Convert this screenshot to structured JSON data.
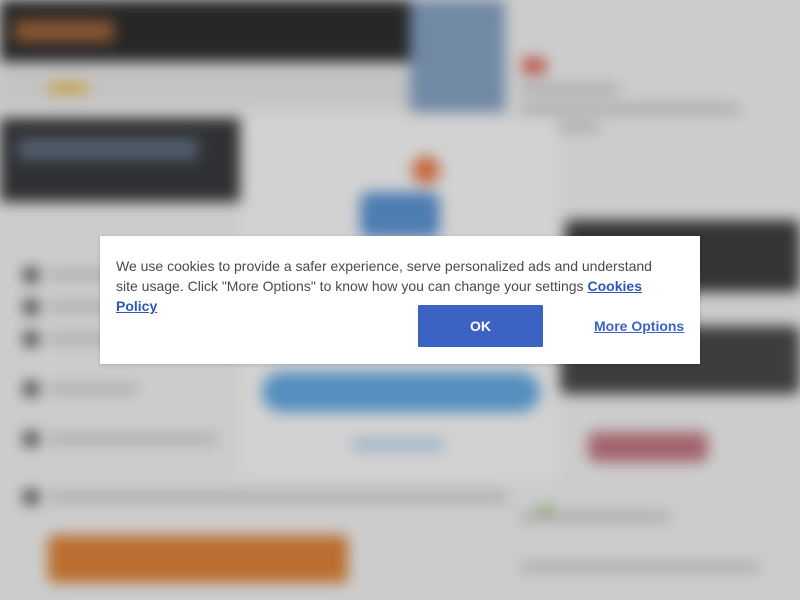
{
  "cookie_banner": {
    "message": "We use cookies to provide a safer experience, serve personalized ads and understand site usage. Click \"More Options\" to know how you can change your settings",
    "policy_link": "Cookies Policy",
    "ok_label": "OK",
    "more_options_label": "More Options"
  },
  "colors": {
    "ok_button": "#3c63c4",
    "link": "#2f57b8",
    "banner_bg": "#ffffff"
  }
}
